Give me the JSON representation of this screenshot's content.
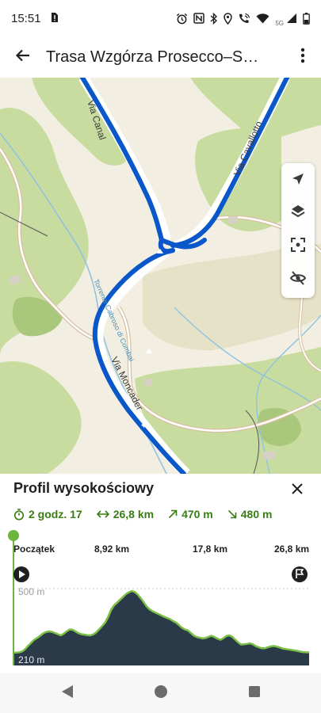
{
  "status_bar": {
    "time": "15:51",
    "network_label": "5G",
    "icons": [
      "sim-alert-icon",
      "alarm-icon",
      "nfc-icon",
      "bluetooth-icon",
      "location-icon",
      "wifi-call-icon",
      "wifi-icon",
      "signal-icon",
      "battery-icon"
    ]
  },
  "app_bar": {
    "title": "Trasa Wzgórza Prosecco–S…",
    "back_icon": "arrow-back-icon",
    "menu_icon": "more-vert-icon"
  },
  "map": {
    "street_labels": {
      "via_canal": "Via Canal",
      "via_cavallotto": "Via Cavallotto",
      "via_moncader": "Via Moncader",
      "torrente": "Torrente Cabroso di Combai"
    },
    "controls": [
      "navigation-arrow-icon",
      "layers-icon",
      "recenter-icon",
      "visibility-off-icon"
    ],
    "colors": {
      "route": "#0a57c9",
      "forest": "#c9dca0",
      "dark_forest": "#a9c87c",
      "land": "#f2efe2",
      "water": "#8fc3df",
      "road_casing": "#d8bfa0"
    }
  },
  "sheet": {
    "title": "Profil wysokościowy",
    "stats": {
      "duration": "2 godz. 17",
      "distance": "26,8 km",
      "ascent": "470 m",
      "descent": "480 m"
    },
    "profile": {
      "distance_labels": [
        "Początek",
        "8,92 km",
        "17,8 km",
        "26,8 km"
      ],
      "max_label": "500 m",
      "min_label": "210 m",
      "colors": {
        "fill": "#2b3a48",
        "line": "#7ac046",
        "steep": "#e0703a",
        "marker": "#6fb43d"
      },
      "elevation_m": [
        228,
        228,
        229,
        233,
        243,
        257,
        270,
        282,
        290,
        299,
        309,
        315,
        318,
        316,
        311,
        306,
        301,
        308,
        318,
        326,
        325,
        318,
        310,
        306,
        304,
        302,
        301,
        305,
        314,
        327,
        341,
        355,
        379,
        409,
        428,
        440,
        452,
        464,
        476,
        484,
        490,
        486,
        475,
        460,
        443,
        425,
        412,
        404,
        398,
        392,
        386,
        380,
        375,
        370,
        362,
        355,
        345,
        333,
        326,
        322,
        311,
        300,
        294,
        291,
        288,
        290,
        295,
        299,
        294,
        287,
        282,
        289,
        298,
        301,
        295,
        283,
        271,
        262,
        263,
        265,
        267,
        263,
        255,
        250,
        246,
        246,
        250,
        254,
        256,
        253,
        250,
        245,
        243,
        241,
        239,
        237,
        235,
        232,
        230,
        229,
        229
      ]
    }
  },
  "nav_bar": {
    "icons": [
      "back-triangle-icon",
      "home-circle-icon",
      "recents-square-icon"
    ]
  }
}
